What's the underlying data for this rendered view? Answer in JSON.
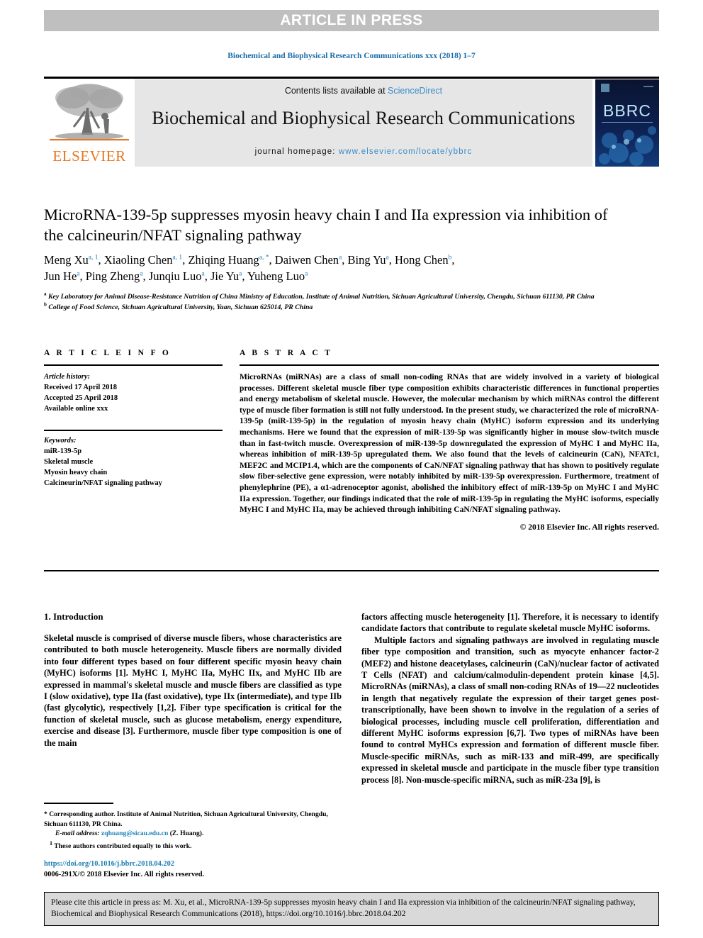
{
  "banner": {
    "text": "ARTICLE IN PRESS"
  },
  "running_head": "Biochemical and Biophysical Research Communications xxx (2018) 1–7",
  "masthead": {
    "contents_prefix": "Contents lists available at ",
    "sciencedirect": "ScienceDirect",
    "journal_title": "Biochemical and Biophysical Research Communications",
    "homepage_label": "journal homepage:",
    "homepage_url": "www.elsevier.com/locate/ybbrc",
    "publisher_wordmark": "ELSEVIER",
    "cover_wordmark": "BBRC",
    "accent_link_color": "#3a8cc8",
    "publisher_color": "#e87722"
  },
  "article": {
    "title": "MicroRNA-139-5p suppresses myosin heavy chain I and IIa expression via inhibition of the calcineurin/NFAT signaling pathway",
    "authors_line1_parts": [
      {
        "name": "Meng Xu",
        "sup": "a, 1",
        "sep": ", "
      },
      {
        "name": "Xiaoling Chen",
        "sup": "a, 1",
        "sep": ", "
      },
      {
        "name": "Zhiqing Huang",
        "sup": "a, *",
        "sep": ", "
      },
      {
        "name": "Daiwen Chen",
        "sup": "a",
        "sep": ", "
      },
      {
        "name": "Bing Yu",
        "sup": "a",
        "sep": ", "
      },
      {
        "name": "Hong Chen",
        "sup": "b",
        "sep": ","
      }
    ],
    "authors_line2_parts": [
      {
        "name": "Jun He",
        "sup": "a",
        "sep": ", "
      },
      {
        "name": "Ping Zheng",
        "sup": "a",
        "sep": ", "
      },
      {
        "name": "Junqiu Luo",
        "sup": "a",
        "sep": ", "
      },
      {
        "name": "Jie Yu",
        "sup": "a",
        "sep": ", "
      },
      {
        "name": "Yuheng Luo",
        "sup": "a",
        "sep": ""
      }
    ],
    "affiliation_a": "Key Laboratory for Animal Disease-Resistance Nutrition of China Ministry of Education, Institute of Animal Nutrition, Sichuan Agricultural University, Chengdu, Sichuan 611130, PR China",
    "affiliation_b": "College of Food Science, Sichuan Agricultural University, Yaan, Sichuan 625014, PR China"
  },
  "article_info": {
    "heading": "A R T I C L E   I N F O",
    "history_label": "Article history:",
    "history": [
      "Received 17 April 2018",
      "Accepted 25 April 2018",
      "Available online xxx"
    ],
    "keywords_label": "Keywords:",
    "keywords": [
      "miR-139-5p",
      "Skeletal muscle",
      "Myosin heavy chain",
      "Calcineurin/NFAT signaling pathway"
    ]
  },
  "abstract": {
    "heading": "A B S T R A C T",
    "body": "MicroRNAs (miRNAs) are a class of small non-coding RNAs that are widely involved in a variety of biological processes. Different skeletal muscle fiber type composition exhibits characteristic differences in functional properties and energy metabolism of skeletal muscle. However, the molecular mechanism by which miRNAs control the different type of muscle fiber formation is still not fully understood. In the present study, we characterized the role of microRNA-139-5p (miR-139-5p) in the regulation of myosin heavy chain (MyHC) isoform expression and its underlying mechanisms. Here we found that the expression of miR-139-5p was significantly higher in mouse slow-twitch muscle than in fast-twitch muscle. Overexpression of miR-139-5p downregulated the expression of MyHC I and MyHC IIa, whereas inhibition of miR-139-5p upregulated them. We also found that the levels of calcineurin (CaN), NFATc1, MEF2C and MCIP1.4, which are the components of CaN/NFAT signaling pathway that has shown to positively regulate slow fiber-selective gene expression, were notably inhibited by miR-139-5p overexpression. Furthermore, treatment of phenylephrine (PE), a α1-adrenoceptor agonist, abolished the inhibitory effect of miR-139-5p on MyHC I and MyHC IIa expression. Together, our findings indicated that the role of miR-139-5p in regulating the MyHC isoforms, especially MyHC I and MyHC IIa, may be achieved through inhibiting CaN/NFAT signaling pathway.",
    "copyright": "© 2018 Elsevier Inc. All rights reserved."
  },
  "introduction": {
    "heading": "1. Introduction",
    "left_paragraphs": [
      "Skeletal muscle is comprised of diverse muscle fibers, whose characteristics are contributed to both muscle heterogeneity. Muscle fibers are normally divided into four different types based on four different specific myosin heavy chain (MyHC) isoforms [1]. MyHC I, MyHC IIa, MyHC IIx, and MyHC IIb are expressed in mammal's skeletal muscle and muscle fibers are classified as type I (slow oxidative), type IIa (fast oxidative), type IIx (intermediate), and type IIb (fast glycolytic), respectively [1,2]. Fiber type specification is critical for the function of skeletal muscle, such as glucose metabolism, energy expenditure, exercise and disease [3]. Furthermore, muscle fiber type composition is one of the main"
    ],
    "right_paragraphs": [
      "factors affecting muscle heterogeneity [1]. Therefore, it is necessary to identify candidate factors that contribute to regulate skeletal muscle MyHC isoforms.",
      "Multiple factors and signaling pathways are involved in regulating muscle fiber type composition and transition, such as myocyte enhancer factor-2 (MEF2) and histone deacetylases, calcineurin (CaN)/nuclear factor of activated T Cells (NFAT) and calcium/calmodulin-dependent protein kinase [4,5]. MicroRNAs (miRNAs), a class of small non-coding RNAs of 19—22 nucleotides in length that negatively regulate the expression of their target genes post-transcriptionally, have been shown to involve in the regulation of a series of biological processes, including muscle cell proliferation, differentiation and different MyHC isoforms expression [6,7]. Two types of miRNAs have been found to control MyHCs expression and formation of different muscle fiber. Muscle-specific miRNAs, such as miR-133 and miR-499, are specifically expressed in skeletal muscle and participate in the muscle fiber type transition process [8]. Non-muscle-specific miRNA, such as miR-23a [9], is"
    ]
  },
  "footnotes": {
    "corresponding_marker": "*",
    "corresponding": "Corresponding author. Institute of Animal Nutrition, Sichuan Agricultural University, Chengdu, Sichuan 611130, PR China.",
    "email_label": "E-mail address:",
    "email": "zqhuang@sicau.edu.cn",
    "email_suffix": "(Z. Huang).",
    "equal_marker": "1",
    "equal_contribution": "These authors contributed equally to this work.",
    "doi": "https://doi.org/10.1016/j.bbrc.2018.04.202",
    "issn_line": "0006-291X/© 2018 Elsevier Inc. All rights reserved."
  },
  "cite_box": {
    "text": "Please cite this article in press as: M. Xu, et al., MicroRNA-139-5p suppresses myosin heavy chain I and IIa expression via inhibition of the calcineurin/NFAT signaling pathway, Biochemical and Biophysical Research Communications (2018), https://doi.org/10.1016/j.bbrc.2018.04.202"
  }
}
